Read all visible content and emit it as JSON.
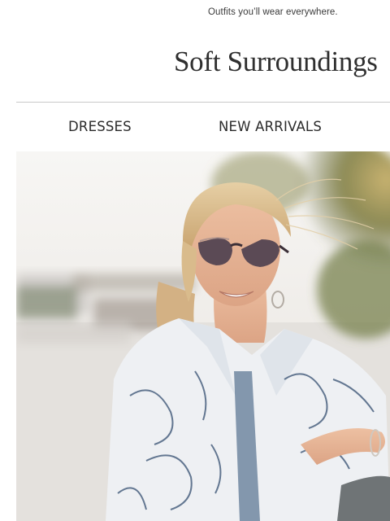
{
  "header": {
    "tagline": "Outfits you’ll wear everywhere.",
    "brand": "Soft Surroundings"
  },
  "nav": {
    "items": [
      {
        "label": "DRESSES"
      },
      {
        "label": "NEW ARRIVALS"
      }
    ]
  },
  "hero": {
    "image_subject": "woman-in-sunglasses-floral-blouse",
    "colors": {
      "sky": "#f3f1ee",
      "sand": "#e7e3df",
      "palm": "#7d8a4d",
      "blouse": "#eef0f3",
      "blouse_print": "#4b6280",
      "hair": "#d8b98c",
      "skin": "#e6b496"
    }
  }
}
